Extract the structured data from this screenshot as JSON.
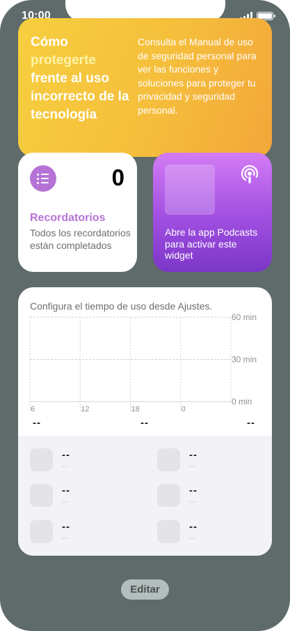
{
  "status_bar": {
    "time": "10:00",
    "signal_icon": "cellular-signal-icon",
    "battery_icon": "battery-icon",
    "battery_level": 1.0
  },
  "safety_widget": {
    "heading_part1": "Cómo",
    "heading_highlight": "protegerte",
    "heading_part2": "frente al uso incorrecto de la tecnología",
    "body": "Consulta el Manual de uso de seguridad personal para ver las funciones y soluciones para proteger tu privacidad y seguridad personal.",
    "colors": {
      "gradient_start": "#f7cf3f",
      "gradient_end": "#f3a63a"
    }
  },
  "reminders_widget": {
    "icon": "list-bullet-icon",
    "count": "0",
    "title": "Recordatorios",
    "subtitle": "Todos los recordatorios están completados",
    "accent": "#b573d6"
  },
  "podcasts_widget": {
    "icon": "podcasts-icon",
    "message": "Abre la app Podcasts para activar este widget",
    "colors": {
      "gradient_start": "#d37cf5",
      "gradient_end": "#7b36c8"
    }
  },
  "screentime_widget": {
    "note": "Configura el tiempo de uso desde Ajustes.",
    "chart_data": {
      "type": "bar",
      "categories": [
        "6",
        "12",
        "18",
        "0"
      ],
      "y_ticks": [
        "60 min",
        "30 min",
        "0 min"
      ],
      "ylim": [
        0,
        60
      ],
      "values": [],
      "grid": true
    },
    "summary": [
      "--",
      "--",
      "--"
    ],
    "apps": [
      {
        "name": "--",
        "time": "--"
      },
      {
        "name": "--",
        "time": "--"
      },
      {
        "name": "--",
        "time": "--"
      },
      {
        "name": "--",
        "time": "--"
      },
      {
        "name": "--",
        "time": "--"
      },
      {
        "name": "--",
        "time": "--"
      }
    ]
  },
  "edit_button": {
    "label": "Editar"
  }
}
